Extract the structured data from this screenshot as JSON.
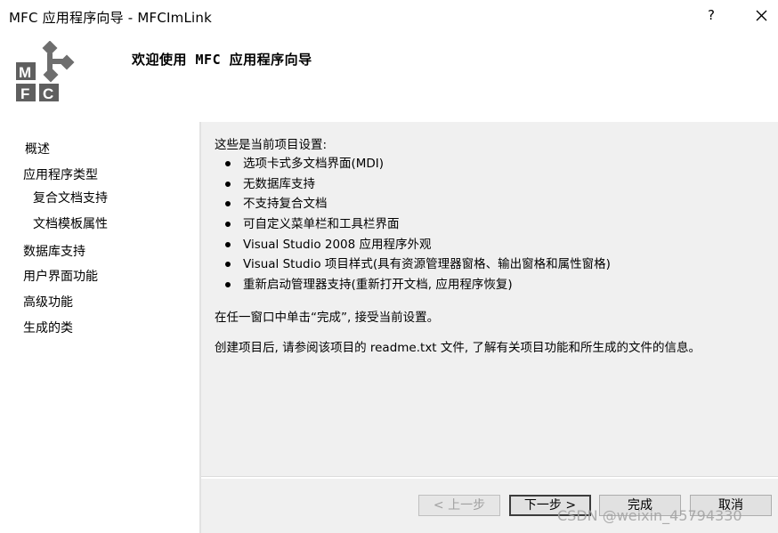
{
  "window": {
    "title": "MFC 应用程序向导 - MFCImLink",
    "help_label": "?"
  },
  "header": {
    "logo_text": [
      "M",
      "F",
      "C"
    ],
    "title": "欢迎使用 MFC 应用程序向导"
  },
  "sidebar": {
    "items": [
      {
        "label": "概述",
        "indent": 0,
        "selected": true
      },
      {
        "label": "应用程序类型",
        "indent": 0
      },
      {
        "label": "复合文档支持",
        "indent": 1
      },
      {
        "label": "文档模板属性",
        "indent": 1
      },
      {
        "label": "数据库支持",
        "indent": 0
      },
      {
        "label": "用户界面功能",
        "indent": 0
      },
      {
        "label": "高级功能",
        "indent": 0
      },
      {
        "label": "生成的类",
        "indent": 0
      }
    ]
  },
  "content": {
    "intro": "这些是当前项目设置:",
    "bullets": [
      "选项卡式多文档界面(MDI)",
      "无数据库支持",
      "不支持复合文档",
      "可自定义菜单栏和工具栏界面",
      "Visual Studio 2008 应用程序外观",
      "Visual Studio 项目样式(具有资源管理器窗格、输出窗格和属性窗格)",
      "重新启动管理器支持(重新打开文档, 应用程序恢复)"
    ],
    "para1": "在任一窗口中单击“完成”, 接受当前设置。",
    "para2": "创建项目后, 请参阅该项目的 readme.txt 文件, 了解有关项目功能和所生成的文件的信息。"
  },
  "buttons": {
    "prev": "< 上一步",
    "next": "下一步 >",
    "finish": "完成",
    "cancel": "取消"
  },
  "watermark": "CSDN @weixin_45794330",
  "colors": {
    "white_panel": "#ffffff",
    "dialog_bg": "#f0f0f0",
    "button_bg": "#e1e1e1"
  }
}
